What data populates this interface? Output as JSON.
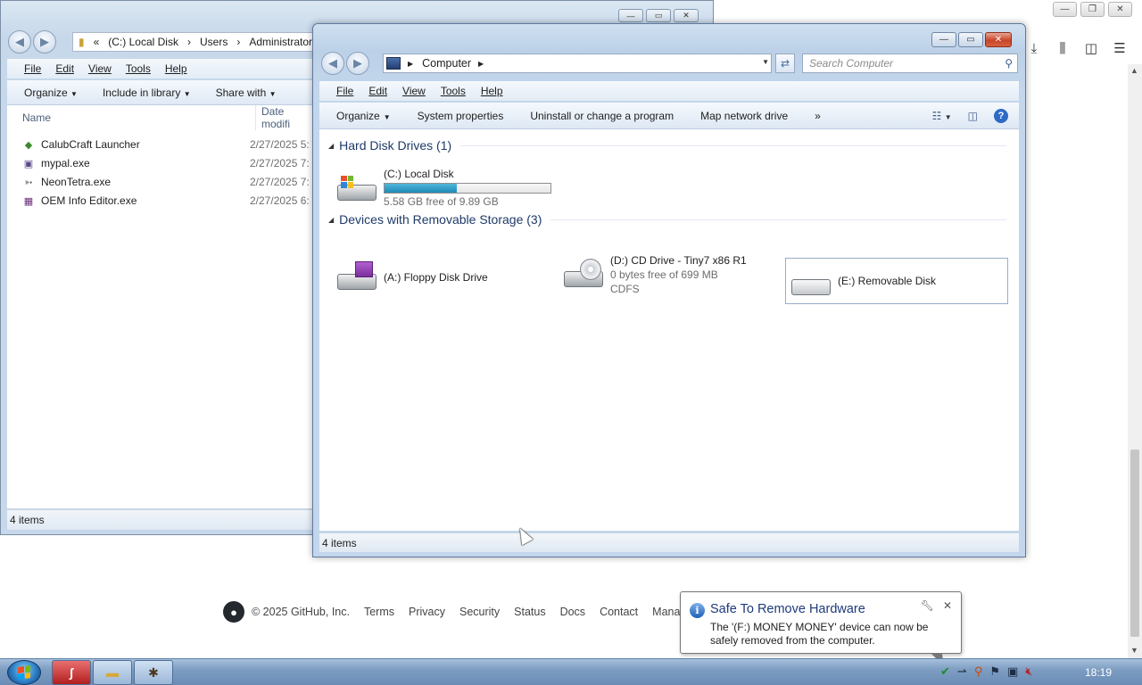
{
  "browser": {
    "caption_min": "—",
    "caption_restore": "❐",
    "caption_close": "✕",
    "toolbar_icons": [
      "download-icon",
      "library-icon",
      "sidebar-icon",
      "menu-icon"
    ],
    "footer": {
      "copyright": "© 2025 GitHub, Inc.",
      "links": [
        "Terms",
        "Privacy",
        "Security",
        "Status",
        "Docs",
        "Contact",
        "Manage c"
      ]
    }
  },
  "back_window": {
    "address_parts": [
      "«",
      "(C:) Local Disk",
      "›",
      "Users",
      "›",
      "Administrator"
    ],
    "menu": [
      "File",
      "Edit",
      "View",
      "Tools",
      "Help"
    ],
    "commands": [
      "Organize",
      "Include in library",
      "Share with"
    ],
    "columns": [
      "Name",
      "Date modifi"
    ],
    "files": [
      {
        "name": "CalubCraft Launcher",
        "date": "2/27/2025 5:",
        "icon": "launcher-icon"
      },
      {
        "name": "mypal.exe",
        "date": "2/27/2025 7:",
        "icon": "app-icon"
      },
      {
        "name": "NeonTetra.exe",
        "date": "2/27/2025 7:",
        "icon": "fish-icon"
      },
      {
        "name": "OEM Info Editor.exe",
        "date": "2/27/2025 6:",
        "icon": "editor-icon"
      }
    ],
    "status": "4 items"
  },
  "computer_window": {
    "address": "Computer",
    "search_placeholder": "Search Computer",
    "menu": [
      "File",
      "Edit",
      "View",
      "Tools",
      "Help"
    ],
    "commands": [
      "Organize",
      "System properties",
      "Uninstall or change a program",
      "Map network drive",
      "»"
    ],
    "groups": [
      {
        "title": "Hard Disk Drives (1)"
      },
      {
        "title": "Devices with Removable Storage (3)"
      }
    ],
    "local_disk": {
      "name": "(C:) Local Disk",
      "free": "5.58 GB free of 9.89 GB",
      "used_fraction": 0.436
    },
    "floppy": {
      "name": "(A:) Floppy Disk Drive"
    },
    "cd": {
      "name": "(D:) CD Drive - Tiny7 x86 R1",
      "free": "0 bytes free of 699 MB",
      "fs": "CDFS"
    },
    "removable": {
      "name": "(E:) Removable Disk"
    },
    "status": "4 items"
  },
  "balloon": {
    "title": "Safe To Remove Hardware",
    "message": "The '(F:) MONEY MONEY' device can now be safely removed from the computer."
  },
  "taskbar": {
    "clock": "18:19",
    "pinned": [
      "flash-icon",
      "explorer-icon",
      "game-icon"
    ]
  }
}
